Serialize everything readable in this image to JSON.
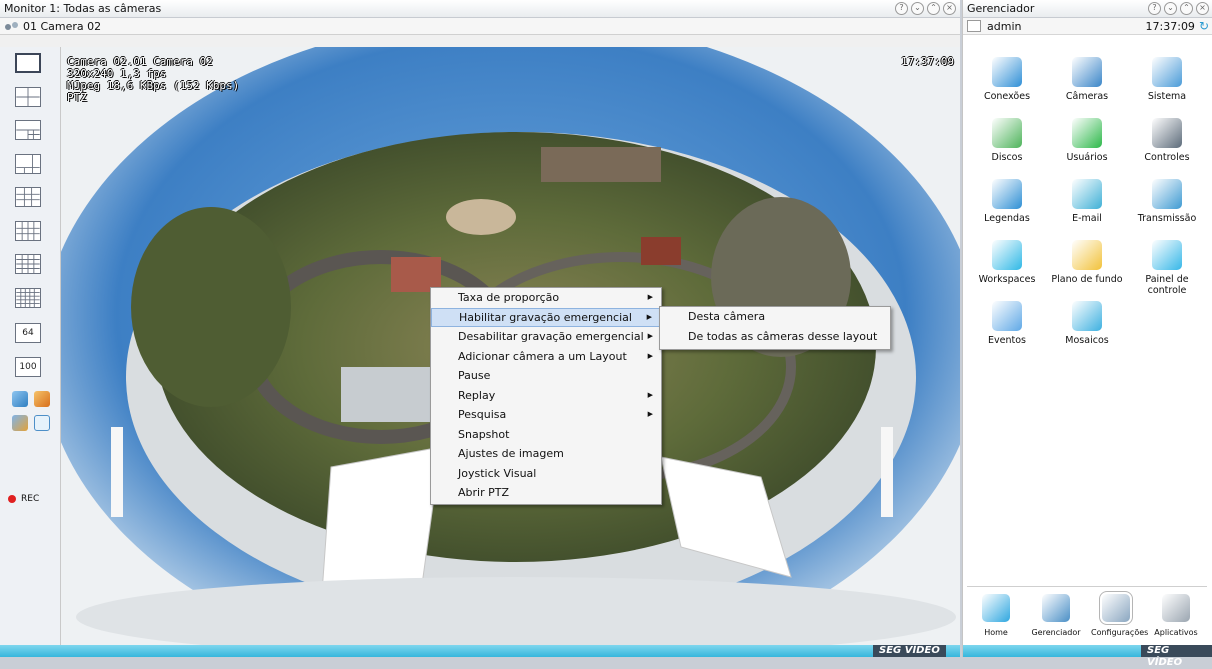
{
  "monitor": {
    "title": "Monitor 1: Todas as câmeras",
    "camera_label": "01 Camera 02"
  },
  "toolbar": {
    "layout_64": "64",
    "layout_100": "100",
    "rec_label": "REC"
  },
  "osd": {
    "line1": "Camera 02.01 Camera 02",
    "line2": "320x240 1,3 fps",
    "line3": "MJpeg 18,6 KBps (152 Kbps)",
    "line4": "PTZ",
    "time": "17:37:09"
  },
  "context_menu": {
    "items": [
      {
        "label": "Taxa de proporção",
        "submenu": true
      },
      {
        "label": "Habilitar gravação emergencial",
        "submenu": true,
        "highlighted": true
      },
      {
        "label": "Desabilitar gravação emergencial",
        "submenu": true
      },
      {
        "label": "Adicionar câmera a um Layout",
        "submenu": true
      },
      {
        "label": "Pause",
        "submenu": false
      },
      {
        "label": "Replay",
        "submenu": true
      },
      {
        "label": "Pesquisa",
        "submenu": true
      },
      {
        "label": "Snapshot",
        "submenu": false
      },
      {
        "label": "Ajustes de imagem",
        "submenu": false
      },
      {
        "label": "Joystick Visual",
        "submenu": false
      },
      {
        "label": "Abrir PTZ",
        "submenu": false
      }
    ],
    "submenu": [
      {
        "label": "Desta câmera",
        "highlighted": false
      },
      {
        "label": "De todas as câmeras desse layout",
        "highlighted": false
      }
    ]
  },
  "manager": {
    "title": "Gerenciador",
    "user": "admin",
    "time": "17:37:09",
    "items": [
      {
        "label": "Conexões",
        "icon": "connections-icon"
      },
      {
        "label": "Câmeras",
        "icon": "cameras-icon"
      },
      {
        "label": "Sistema",
        "icon": "system-icon"
      },
      {
        "label": "Discos",
        "icon": "disks-icon"
      },
      {
        "label": "Usuários",
        "icon": "users-icon"
      },
      {
        "label": "Controles",
        "icon": "controls-icon"
      },
      {
        "label": "Legendas",
        "icon": "captions-icon"
      },
      {
        "label": "E-mail",
        "icon": "email-icon"
      },
      {
        "label": "Transmissão",
        "icon": "transmission-icon"
      },
      {
        "label": "Workspaces",
        "icon": "workspaces-icon"
      },
      {
        "label": "Plano de fundo",
        "icon": "background-icon"
      },
      {
        "label": "Painel de controle",
        "icon": "control-panel-icon"
      },
      {
        "label": "Eventos",
        "icon": "events-icon"
      },
      {
        "label": "Mosaicos",
        "icon": "mosaics-icon"
      }
    ],
    "nav": [
      {
        "label": "Home",
        "icon": "home-icon",
        "selected": false
      },
      {
        "label": "Gerenciador",
        "icon": "manager-icon",
        "selected": false
      },
      {
        "label": "Configurações",
        "icon": "settings-icon",
        "selected": true
      },
      {
        "label": "Aplicativos",
        "icon": "apps-icon",
        "selected": false
      }
    ]
  },
  "brand": {
    "text": "SEG VÍDEO",
    "accent_color": "#36b6dc"
  }
}
